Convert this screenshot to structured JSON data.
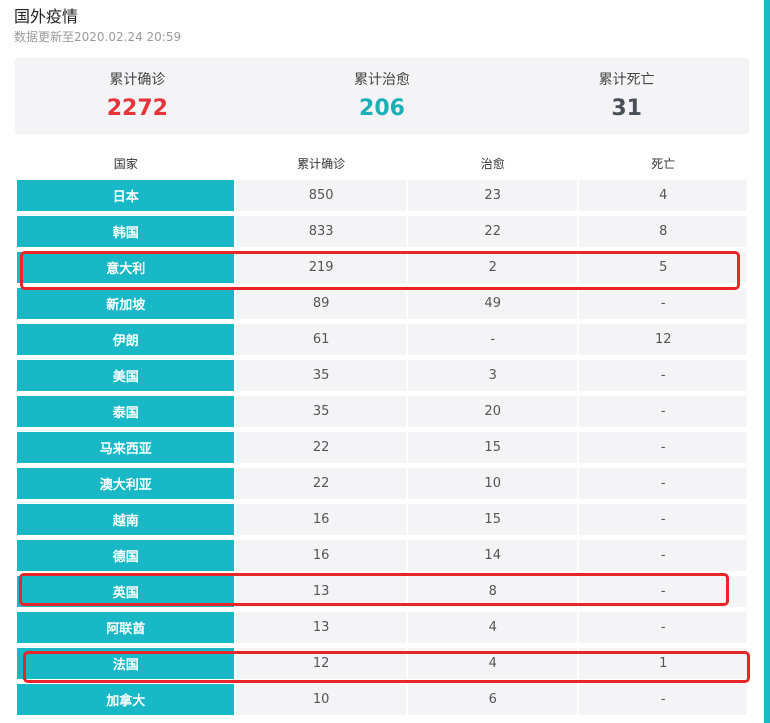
{
  "header": {
    "title": "国外疫情",
    "subtitle": "数据更新至2020.02.24 20:59"
  },
  "summary": [
    {
      "label": "累计确诊",
      "value": "2272",
      "color": "#e5353b"
    },
    {
      "label": "累计治愈",
      "value": "206",
      "color": "#1bb0b5"
    },
    {
      "label": "累计死亡",
      "value": "31",
      "color": "#4a4f57"
    }
  ],
  "table": {
    "headers": [
      "国家",
      "累计确诊",
      "治愈",
      "死亡"
    ],
    "rows": [
      [
        "日本",
        "850",
        "23",
        "4"
      ],
      [
        "韩国",
        "833",
        "22",
        "8"
      ],
      [
        "意大利",
        "219",
        "2",
        "5"
      ],
      [
        "新加坡",
        "89",
        "49",
        "-"
      ],
      [
        "伊朗",
        "61",
        "-",
        "12"
      ],
      [
        "美国",
        "35",
        "3",
        "-"
      ],
      [
        "泰国",
        "35",
        "20",
        "-"
      ],
      [
        "马来西亚",
        "22",
        "15",
        "-"
      ],
      [
        "澳大利亚",
        "22",
        "10",
        "-"
      ],
      [
        "越南",
        "16",
        "15",
        "-"
      ],
      [
        "德国",
        "16",
        "14",
        "-"
      ],
      [
        "英国",
        "13",
        "8",
        "-"
      ],
      [
        "阿联酋",
        "13",
        "4",
        "-"
      ],
      [
        "法国",
        "12",
        "4",
        "1"
      ],
      [
        "加拿大",
        "10",
        "6",
        "-"
      ]
    ]
  },
  "colors": {
    "accent": "#18b8c6",
    "highlight": "#e8262a",
    "cell_bg": "#f4f4f6"
  }
}
